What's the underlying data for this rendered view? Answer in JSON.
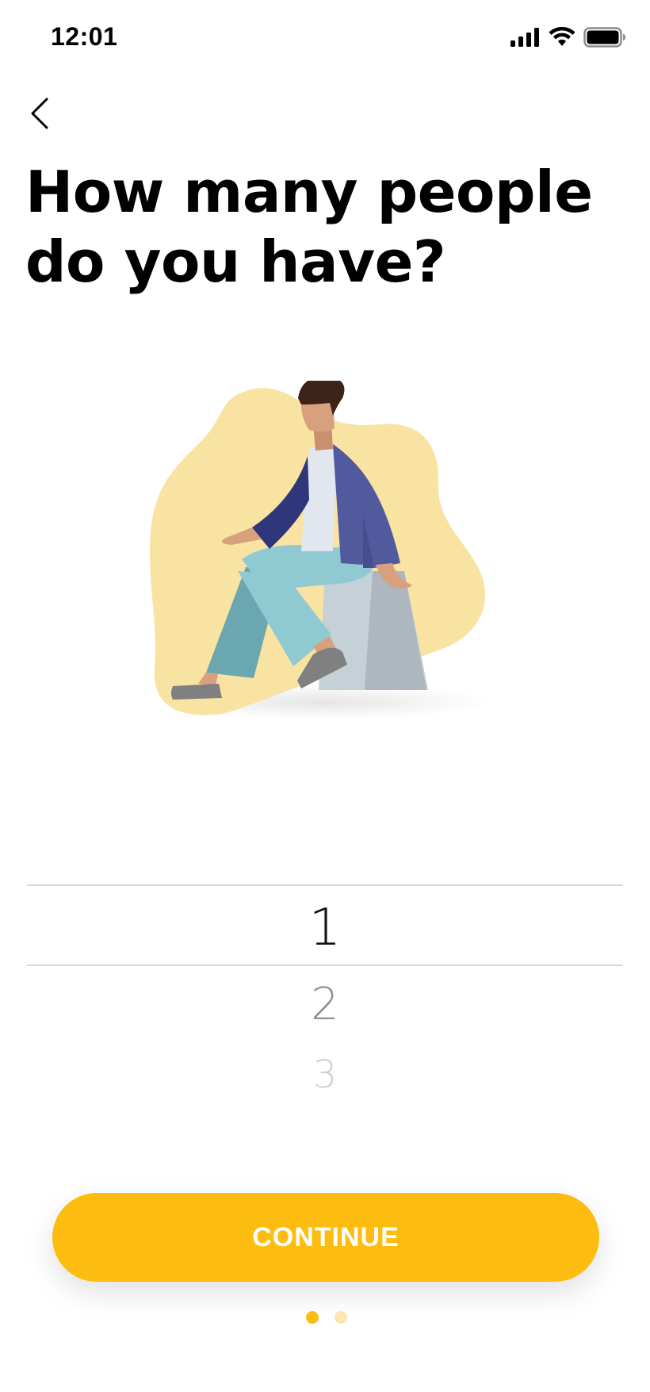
{
  "status_bar": {
    "time": "12:01",
    "icons": [
      "signal-icon",
      "wifi-icon",
      "battery-icon"
    ]
  },
  "nav": {
    "back_icon": "chevron-left-icon"
  },
  "title": "How many people do you have?",
  "illustration": {
    "icon": "person-sitting-illustration",
    "colors": {
      "blob": "#f8e3a2",
      "jacket": "#525a9e",
      "jacket_dark": "#2f3679",
      "pants": "#8fc9d1",
      "pants_dark": "#6aa7b1",
      "skin": "#d9a07e",
      "hair": "#3d2418",
      "rock_light": "#c5d0d7",
      "rock_dark": "#aeb7bf",
      "shoes": "#808080"
    }
  },
  "picker": {
    "options": [
      "1",
      "2",
      "3"
    ],
    "selected": "1"
  },
  "continue_button": {
    "label": "CONTINUE"
  },
  "pagination": {
    "total": 2,
    "current": 1
  },
  "colors": {
    "accent": "#fdbd10",
    "dot_active": "#fdbd10",
    "dot_inactive": "#fbe6b0",
    "divider": "#d9d9dc"
  }
}
